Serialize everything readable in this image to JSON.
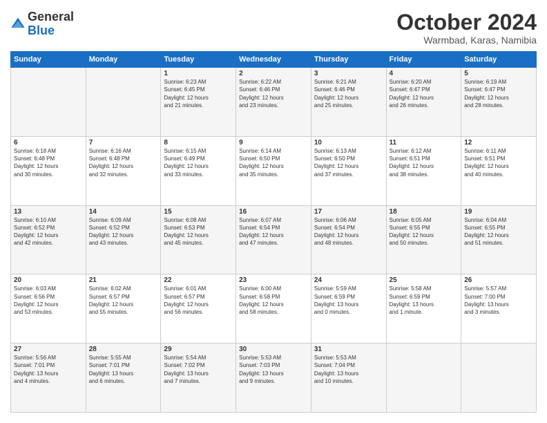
{
  "header": {
    "logo": {
      "general": "General",
      "blue": "Blue"
    },
    "title": "October 2024",
    "location": "Warmbad, Karas, Namibia"
  },
  "calendar": {
    "weekdays": [
      "Sunday",
      "Monday",
      "Tuesday",
      "Wednesday",
      "Thursday",
      "Friday",
      "Saturday"
    ],
    "weeks": [
      [
        {
          "day": "",
          "info": ""
        },
        {
          "day": "",
          "info": ""
        },
        {
          "day": "1",
          "info": "Sunrise: 6:23 AM\nSunset: 6:45 PM\nDaylight: 12 hours\nand 21 minutes."
        },
        {
          "day": "2",
          "info": "Sunrise: 6:22 AM\nSunset: 6:46 PM\nDaylight: 12 hours\nand 23 minutes."
        },
        {
          "day": "3",
          "info": "Sunrise: 6:21 AM\nSunset: 6:46 PM\nDaylight: 12 hours\nand 25 minutes."
        },
        {
          "day": "4",
          "info": "Sunrise: 6:20 AM\nSunset: 6:47 PM\nDaylight: 12 hours\nand 26 minutes."
        },
        {
          "day": "5",
          "info": "Sunrise: 6:19 AM\nSunset: 6:47 PM\nDaylight: 12 hours\nand 28 minutes."
        }
      ],
      [
        {
          "day": "6",
          "info": "Sunrise: 6:18 AM\nSunset: 6:48 PM\nDaylight: 12 hours\nand 30 minutes."
        },
        {
          "day": "7",
          "info": "Sunrise: 6:16 AM\nSunset: 6:48 PM\nDaylight: 12 hours\nand 32 minutes."
        },
        {
          "day": "8",
          "info": "Sunrise: 6:15 AM\nSunset: 6:49 PM\nDaylight: 12 hours\nand 33 minutes."
        },
        {
          "day": "9",
          "info": "Sunrise: 6:14 AM\nSunset: 6:50 PM\nDaylight: 12 hours\nand 35 minutes."
        },
        {
          "day": "10",
          "info": "Sunrise: 6:13 AM\nSunset: 6:50 PM\nDaylight: 12 hours\nand 37 minutes."
        },
        {
          "day": "11",
          "info": "Sunrise: 6:12 AM\nSunset: 6:51 PM\nDaylight: 12 hours\nand 38 minutes."
        },
        {
          "day": "12",
          "info": "Sunrise: 6:11 AM\nSunset: 6:51 PM\nDaylight: 12 hours\nand 40 minutes."
        }
      ],
      [
        {
          "day": "13",
          "info": "Sunrise: 6:10 AM\nSunset: 6:52 PM\nDaylight: 12 hours\nand 42 minutes."
        },
        {
          "day": "14",
          "info": "Sunrise: 6:09 AM\nSunset: 6:52 PM\nDaylight: 12 hours\nand 43 minutes."
        },
        {
          "day": "15",
          "info": "Sunrise: 6:08 AM\nSunset: 6:53 PM\nDaylight: 12 hours\nand 45 minutes."
        },
        {
          "day": "16",
          "info": "Sunrise: 6:07 AM\nSunset: 6:54 PM\nDaylight: 12 hours\nand 47 minutes."
        },
        {
          "day": "17",
          "info": "Sunrise: 6:06 AM\nSunset: 6:54 PM\nDaylight: 12 hours\nand 48 minutes."
        },
        {
          "day": "18",
          "info": "Sunrise: 6:05 AM\nSunset: 6:55 PM\nDaylight: 12 hours\nand 50 minutes."
        },
        {
          "day": "19",
          "info": "Sunrise: 6:04 AM\nSunset: 6:55 PM\nDaylight: 12 hours\nand 51 minutes."
        }
      ],
      [
        {
          "day": "20",
          "info": "Sunrise: 6:03 AM\nSunset: 6:56 PM\nDaylight: 12 hours\nand 53 minutes."
        },
        {
          "day": "21",
          "info": "Sunrise: 6:02 AM\nSunset: 6:57 PM\nDaylight: 12 hours\nand 55 minutes."
        },
        {
          "day": "22",
          "info": "Sunrise: 6:01 AM\nSunset: 6:57 PM\nDaylight: 12 hours\nand 56 minutes."
        },
        {
          "day": "23",
          "info": "Sunrise: 6:00 AM\nSunset: 6:58 PM\nDaylight: 12 hours\nand 58 minutes."
        },
        {
          "day": "24",
          "info": "Sunrise: 5:59 AM\nSunset: 6:59 PM\nDaylight: 13 hours\nand 0 minutes."
        },
        {
          "day": "25",
          "info": "Sunrise: 5:58 AM\nSunset: 6:59 PM\nDaylight: 13 hours\nand 1 minute."
        },
        {
          "day": "26",
          "info": "Sunrise: 5:57 AM\nSunset: 7:00 PM\nDaylight: 13 hours\nand 3 minutes."
        }
      ],
      [
        {
          "day": "27",
          "info": "Sunrise: 5:56 AM\nSunset: 7:01 PM\nDaylight: 13 hours\nand 4 minutes."
        },
        {
          "day": "28",
          "info": "Sunrise: 5:55 AM\nSunset: 7:01 PM\nDaylight: 13 hours\nand 6 minutes."
        },
        {
          "day": "29",
          "info": "Sunrise: 5:54 AM\nSunset: 7:02 PM\nDaylight: 13 hours\nand 7 minutes."
        },
        {
          "day": "30",
          "info": "Sunrise: 5:53 AM\nSunset: 7:03 PM\nDaylight: 13 hours\nand 9 minutes."
        },
        {
          "day": "31",
          "info": "Sunrise: 5:53 AM\nSunset: 7:04 PM\nDaylight: 13 hours\nand 10 minutes."
        },
        {
          "day": "",
          "info": ""
        },
        {
          "day": "",
          "info": ""
        }
      ]
    ]
  }
}
